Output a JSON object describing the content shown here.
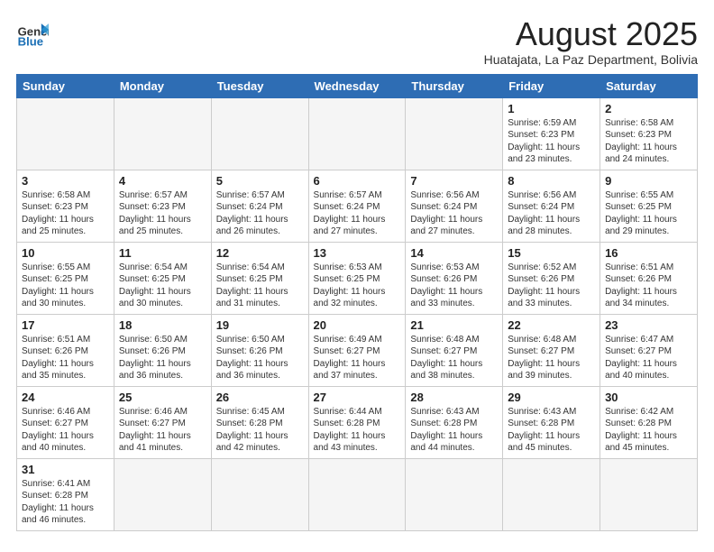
{
  "header": {
    "logo_general": "General",
    "logo_blue": "Blue",
    "main_title": "August 2025",
    "subtitle": "Huatajata, La Paz Department, Bolivia"
  },
  "weekdays": [
    "Sunday",
    "Monday",
    "Tuesday",
    "Wednesday",
    "Thursday",
    "Friday",
    "Saturday"
  ],
  "weeks": [
    [
      {
        "day": "",
        "info": ""
      },
      {
        "day": "",
        "info": ""
      },
      {
        "day": "",
        "info": ""
      },
      {
        "day": "",
        "info": ""
      },
      {
        "day": "",
        "info": ""
      },
      {
        "day": "1",
        "info": "Sunrise: 6:59 AM\nSunset: 6:23 PM\nDaylight: 11 hours\nand 23 minutes."
      },
      {
        "day": "2",
        "info": "Sunrise: 6:58 AM\nSunset: 6:23 PM\nDaylight: 11 hours\nand 24 minutes."
      }
    ],
    [
      {
        "day": "3",
        "info": "Sunrise: 6:58 AM\nSunset: 6:23 PM\nDaylight: 11 hours\nand 25 minutes."
      },
      {
        "day": "4",
        "info": "Sunrise: 6:57 AM\nSunset: 6:23 PM\nDaylight: 11 hours\nand 25 minutes."
      },
      {
        "day": "5",
        "info": "Sunrise: 6:57 AM\nSunset: 6:24 PM\nDaylight: 11 hours\nand 26 minutes."
      },
      {
        "day": "6",
        "info": "Sunrise: 6:57 AM\nSunset: 6:24 PM\nDaylight: 11 hours\nand 27 minutes."
      },
      {
        "day": "7",
        "info": "Sunrise: 6:56 AM\nSunset: 6:24 PM\nDaylight: 11 hours\nand 27 minutes."
      },
      {
        "day": "8",
        "info": "Sunrise: 6:56 AM\nSunset: 6:24 PM\nDaylight: 11 hours\nand 28 minutes."
      },
      {
        "day": "9",
        "info": "Sunrise: 6:55 AM\nSunset: 6:25 PM\nDaylight: 11 hours\nand 29 minutes."
      }
    ],
    [
      {
        "day": "10",
        "info": "Sunrise: 6:55 AM\nSunset: 6:25 PM\nDaylight: 11 hours\nand 30 minutes."
      },
      {
        "day": "11",
        "info": "Sunrise: 6:54 AM\nSunset: 6:25 PM\nDaylight: 11 hours\nand 30 minutes."
      },
      {
        "day": "12",
        "info": "Sunrise: 6:54 AM\nSunset: 6:25 PM\nDaylight: 11 hours\nand 31 minutes."
      },
      {
        "day": "13",
        "info": "Sunrise: 6:53 AM\nSunset: 6:25 PM\nDaylight: 11 hours\nand 32 minutes."
      },
      {
        "day": "14",
        "info": "Sunrise: 6:53 AM\nSunset: 6:26 PM\nDaylight: 11 hours\nand 33 minutes."
      },
      {
        "day": "15",
        "info": "Sunrise: 6:52 AM\nSunset: 6:26 PM\nDaylight: 11 hours\nand 33 minutes."
      },
      {
        "day": "16",
        "info": "Sunrise: 6:51 AM\nSunset: 6:26 PM\nDaylight: 11 hours\nand 34 minutes."
      }
    ],
    [
      {
        "day": "17",
        "info": "Sunrise: 6:51 AM\nSunset: 6:26 PM\nDaylight: 11 hours\nand 35 minutes."
      },
      {
        "day": "18",
        "info": "Sunrise: 6:50 AM\nSunset: 6:26 PM\nDaylight: 11 hours\nand 36 minutes."
      },
      {
        "day": "19",
        "info": "Sunrise: 6:50 AM\nSunset: 6:26 PM\nDaylight: 11 hours\nand 36 minutes."
      },
      {
        "day": "20",
        "info": "Sunrise: 6:49 AM\nSunset: 6:27 PM\nDaylight: 11 hours\nand 37 minutes."
      },
      {
        "day": "21",
        "info": "Sunrise: 6:48 AM\nSunset: 6:27 PM\nDaylight: 11 hours\nand 38 minutes."
      },
      {
        "day": "22",
        "info": "Sunrise: 6:48 AM\nSunset: 6:27 PM\nDaylight: 11 hours\nand 39 minutes."
      },
      {
        "day": "23",
        "info": "Sunrise: 6:47 AM\nSunset: 6:27 PM\nDaylight: 11 hours\nand 40 minutes."
      }
    ],
    [
      {
        "day": "24",
        "info": "Sunrise: 6:46 AM\nSunset: 6:27 PM\nDaylight: 11 hours\nand 40 minutes."
      },
      {
        "day": "25",
        "info": "Sunrise: 6:46 AM\nSunset: 6:27 PM\nDaylight: 11 hours\nand 41 minutes."
      },
      {
        "day": "26",
        "info": "Sunrise: 6:45 AM\nSunset: 6:28 PM\nDaylight: 11 hours\nand 42 minutes."
      },
      {
        "day": "27",
        "info": "Sunrise: 6:44 AM\nSunset: 6:28 PM\nDaylight: 11 hours\nand 43 minutes."
      },
      {
        "day": "28",
        "info": "Sunrise: 6:43 AM\nSunset: 6:28 PM\nDaylight: 11 hours\nand 44 minutes."
      },
      {
        "day": "29",
        "info": "Sunrise: 6:43 AM\nSunset: 6:28 PM\nDaylight: 11 hours\nand 45 minutes."
      },
      {
        "day": "30",
        "info": "Sunrise: 6:42 AM\nSunset: 6:28 PM\nDaylight: 11 hours\nand 45 minutes."
      }
    ],
    [
      {
        "day": "31",
        "info": "Sunrise: 6:41 AM\nSunset: 6:28 PM\nDaylight: 11 hours\nand 46 minutes."
      },
      {
        "day": "",
        "info": ""
      },
      {
        "day": "",
        "info": ""
      },
      {
        "day": "",
        "info": ""
      },
      {
        "day": "",
        "info": ""
      },
      {
        "day": "",
        "info": ""
      },
      {
        "day": "",
        "info": ""
      }
    ]
  ]
}
